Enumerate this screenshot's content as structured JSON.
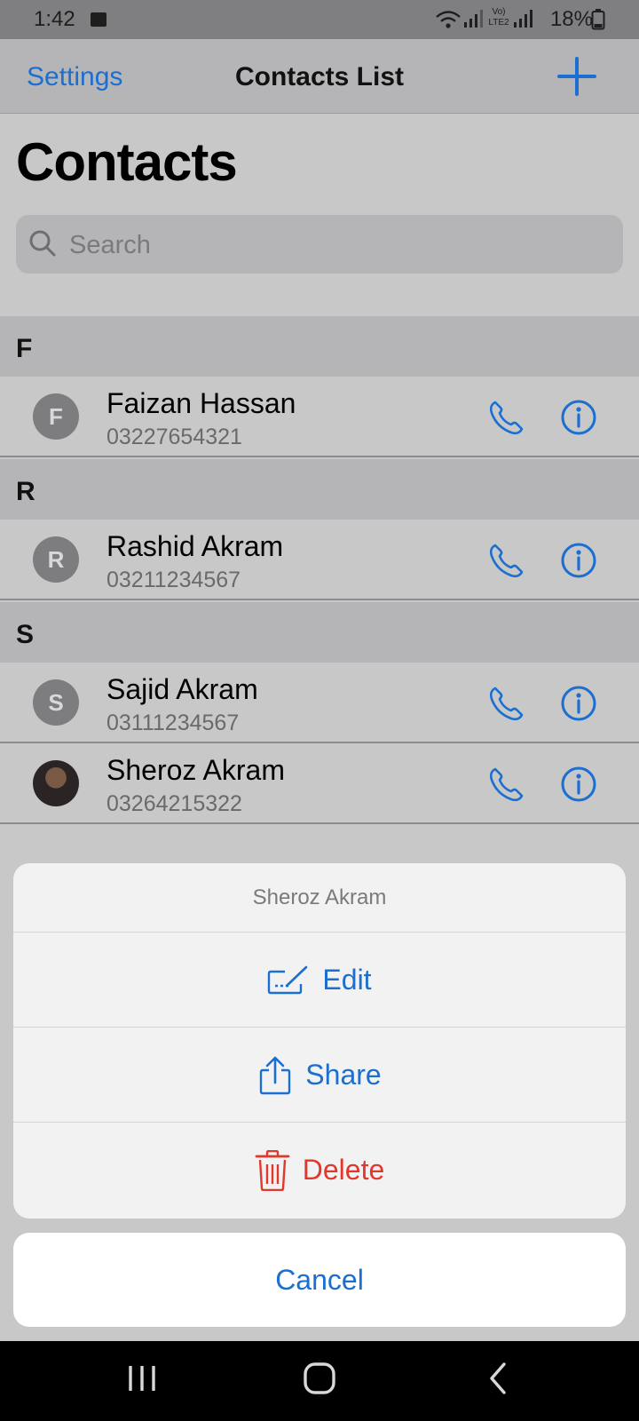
{
  "status_bar": {
    "time": "1:42",
    "network": "Vo) LTE2",
    "battery": "18%"
  },
  "nav": {
    "left_label": "Settings",
    "title": "Contacts List",
    "add_icon": "plus-icon"
  },
  "page_title": "Contacts",
  "search": {
    "placeholder": "Search",
    "icon": "search-icon"
  },
  "sections": [
    {
      "letter": "F",
      "contacts": [
        {
          "initial": "F",
          "name": "Faizan Hassan",
          "phone": "03227654321"
        }
      ]
    },
    {
      "letter": "R",
      "contacts": [
        {
          "initial": "R",
          "name": "Rashid Akram",
          "phone": "03211234567"
        }
      ]
    },
    {
      "letter": "S",
      "contacts": [
        {
          "initial": "S",
          "name": "Sajid Akram",
          "phone": "03111234567"
        },
        {
          "initial": "",
          "name": "Sheroz Akram",
          "phone": "03264215322"
        }
      ]
    }
  ],
  "action_sheet": {
    "title": "Sheroz Akram",
    "actions": [
      {
        "label": "Edit",
        "icon": "edit-icon",
        "color": "#1a6fd0"
      },
      {
        "label": "Share",
        "icon": "share-icon",
        "color": "#1a6fd0"
      },
      {
        "label": "Delete",
        "icon": "trash-icon",
        "color": "#e0382c"
      }
    ],
    "cancel_label": "Cancel"
  },
  "colors": {
    "accent": "#1a6fd0",
    "destructive": "#e0382c"
  }
}
